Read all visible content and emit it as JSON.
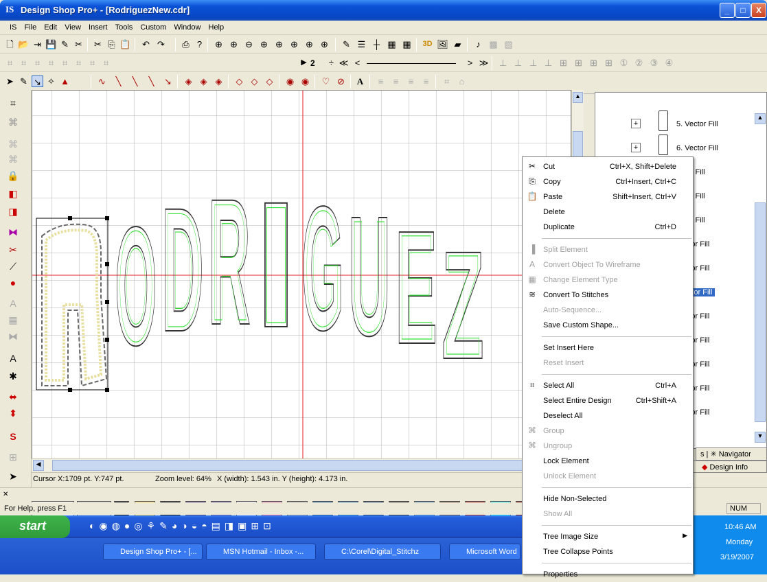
{
  "window": {
    "title": "Design Shop Pro+ - [RodriguezNew.cdr]",
    "min": "_",
    "max": "□",
    "close": "X"
  },
  "menu": [
    "File",
    "Edit",
    "View",
    "Insert",
    "Tools",
    "Custom",
    "Window",
    "Help"
  ],
  "toolbar2": {
    "stitch_count": "2"
  },
  "canvas": {
    "design_text": "RODRIGUEZ"
  },
  "status": {
    "cursor": "Cursor X:1709 pt. Y:747 pt.",
    "zoom": "Zoom level: 64%",
    "size": "X (width): 1.543 in.  Y (height): 4.173 in."
  },
  "help": "For Help, press F1",
  "num_indicator": "NUM",
  "palette": {
    "number": "1",
    "colors": [
      "#ffffff",
      "#f5dc5a",
      "#000000",
      "#4a3a7a",
      "#6a5aa0",
      "#e8e8f8",
      "#d86aa0",
      "#a0a0a0",
      "#1a5a9a",
      "#2a7ab8",
      "#1a3a6a",
      "#2a2a2a",
      "#5a8ab8",
      "#6a4a3a",
      "#b02020",
      "#20f0f0",
      "#7a0a0a"
    ]
  },
  "tree": {
    "items": [
      "5. Vector Fill",
      "6. Vector Fill",
      "ector Fill",
      "ector Fill",
      "ector Fill",
      "Vector Fill",
      "Vector Fill",
      "Vector Fill",
      "Vector Fill",
      "Vector Fill",
      "Vector Fill",
      "Vector Fill",
      "Vector Fill"
    ]
  },
  "tabs": {
    "navigator": "Navigator",
    "design_info": "Design Info",
    "extra": "s"
  },
  "context_menu": [
    {
      "label": "Cut",
      "shortcut": "Ctrl+X, Shift+Delete",
      "icon": "scissors-icon",
      "disabled": false
    },
    {
      "label": "Copy",
      "shortcut": "Ctrl+Insert, Ctrl+C",
      "icon": "copy-icon",
      "disabled": false
    },
    {
      "label": "Paste",
      "shortcut": "Shift+Insert, Ctrl+V",
      "icon": "paste-icon",
      "disabled": false
    },
    {
      "label": "Delete",
      "shortcut": "",
      "icon": "",
      "disabled": false
    },
    {
      "label": "Duplicate",
      "shortcut": "Ctrl+D",
      "icon": "",
      "disabled": false
    },
    {
      "sep": true
    },
    {
      "label": "Split Element",
      "shortcut": "",
      "icon": "split-icon",
      "disabled": true
    },
    {
      "label": "Convert Object To Wireframe",
      "shortcut": "",
      "icon": "wireframe-icon",
      "disabled": true
    },
    {
      "label": "Change Element Type",
      "shortcut": "",
      "icon": "element-type-icon",
      "disabled": true
    },
    {
      "label": "Convert To Stitches",
      "shortcut": "",
      "icon": "stitches-icon",
      "disabled": false
    },
    {
      "label": "Auto-Sequence...",
      "shortcut": "",
      "icon": "",
      "disabled": true
    },
    {
      "label": "Save Custom Shape...",
      "shortcut": "",
      "icon": "",
      "disabled": false
    },
    {
      "sep": true
    },
    {
      "label": "Set Insert Here",
      "shortcut": "",
      "icon": "",
      "disabled": false
    },
    {
      "label": "Reset Insert",
      "shortcut": "",
      "icon": "",
      "disabled": true
    },
    {
      "sep": true
    },
    {
      "label": "Select All",
      "shortcut": "Ctrl+A",
      "icon": "select-all-icon",
      "disabled": false
    },
    {
      "label": "Select Entire Design",
      "shortcut": "Ctrl+Shift+A",
      "icon": "",
      "disabled": false
    },
    {
      "label": "Deselect All",
      "shortcut": "",
      "icon": "",
      "disabled": false
    },
    {
      "label": "Group",
      "shortcut": "",
      "icon": "group-icon",
      "disabled": true
    },
    {
      "label": "Ungroup",
      "shortcut": "",
      "icon": "ungroup-icon",
      "disabled": true
    },
    {
      "label": "Lock Element",
      "shortcut": "",
      "icon": "",
      "disabled": false
    },
    {
      "label": "Unlock Element",
      "shortcut": "",
      "icon": "",
      "disabled": true
    },
    {
      "sep": true
    },
    {
      "label": "Hide Non-Selected",
      "shortcut": "",
      "icon": "",
      "disabled": false
    },
    {
      "label": "Show All",
      "shortcut": "",
      "icon": "",
      "disabled": true
    },
    {
      "sep": true
    },
    {
      "label": "Tree Image Size",
      "shortcut": "",
      "icon": "",
      "disabled": false,
      "submenu": true
    },
    {
      "label": "Tree Collapse Points",
      "shortcut": "",
      "icon": "",
      "disabled": false
    },
    {
      "sep": true
    },
    {
      "label": "Properties",
      "shortcut": "",
      "icon": "",
      "disabled": false
    }
  ],
  "taskbar": {
    "start": "start",
    "tasks": [
      "Design Shop Pro+ - [...",
      "MSN Hotmail - Inbox -...",
      "C:\\Corel\\Digital_Stitchz",
      "Microsoft Word"
    ],
    "time": "10:46 AM",
    "day": "Monday",
    "date": "3/19/2007"
  }
}
